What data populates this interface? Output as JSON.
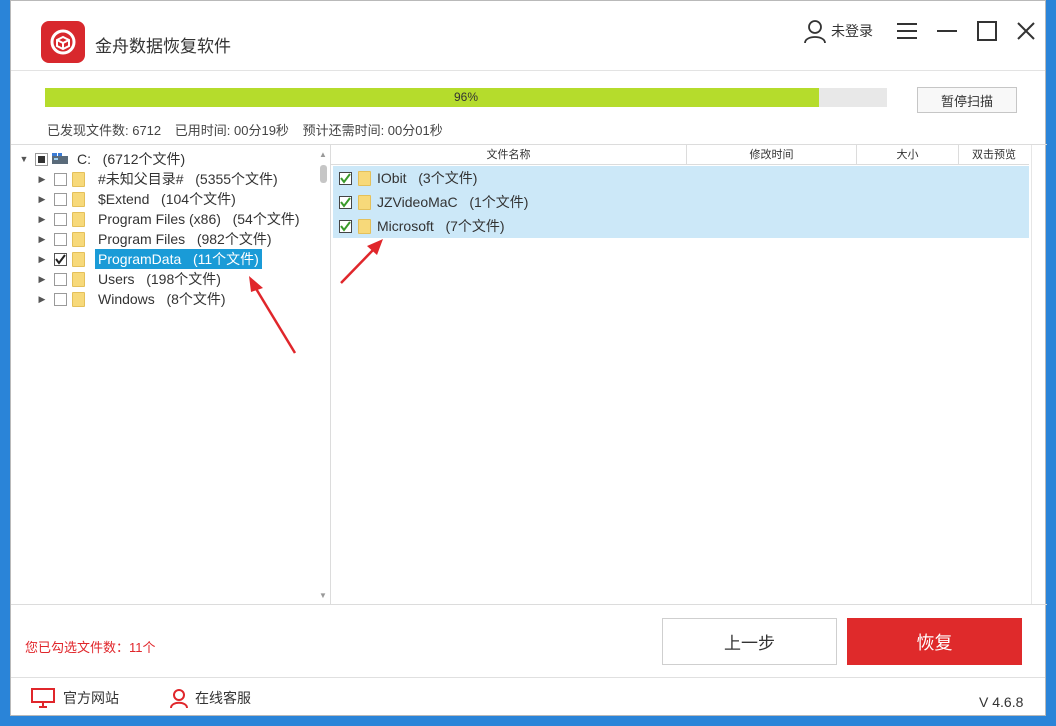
{
  "app": {
    "title": "金舟数据恢复软件",
    "user_label": "未登录"
  },
  "progress": {
    "percent": 96,
    "label": "96%",
    "pause_label": "暂停扫描"
  },
  "scan_status": {
    "found": "已发现文件数: 6712",
    "elapsed": "已用时间: 00分19秒",
    "remaining": "预计还需时间: 00分01秒"
  },
  "tree": {
    "root": {
      "label": "C:",
      "count": "(6712个文件)"
    },
    "items": [
      {
        "label": "#未知父目录#",
        "count": "(5355个文件)",
        "checked": false,
        "selected": false
      },
      {
        "label": "$Extend",
        "count": "(104个文件)",
        "checked": false,
        "selected": false
      },
      {
        "label": "Program Files (x86)",
        "count": "(54个文件)",
        "checked": false,
        "selected": false
      },
      {
        "label": "Program Files",
        "count": "(982个文件)",
        "checked": false,
        "selected": false
      },
      {
        "label": "ProgramData",
        "count": "(11个文件)",
        "checked": true,
        "selected": true
      },
      {
        "label": "Users",
        "count": "(198个文件)",
        "checked": false,
        "selected": false
      },
      {
        "label": "Windows",
        "count": "(8个文件)",
        "checked": false,
        "selected": false
      }
    ]
  },
  "list": {
    "columns": [
      "文件名称",
      "修改时间",
      "大小",
      "双击预览"
    ],
    "rows": [
      {
        "name": "IObit",
        "count": "(3个文件)",
        "checked": true
      },
      {
        "name": "JZVideoMaC",
        "count": "(1个文件)",
        "checked": true
      },
      {
        "name": "Microsoft",
        "count": "(7个文件)",
        "checked": true
      }
    ]
  },
  "bottom": {
    "selected_count": "您已勾选文件数：11个",
    "prev_label": "上一步",
    "restore_label": "恢复"
  },
  "footer": {
    "website_label": "官方网站",
    "support_label": "在线客服",
    "version": "V 4.6.8"
  },
  "colors": {
    "brand_red": "#df2a2b",
    "progress_green": "#b5dc2c",
    "selection_blue": "#1a9bd7",
    "row_highlight": "#cce8f8"
  }
}
